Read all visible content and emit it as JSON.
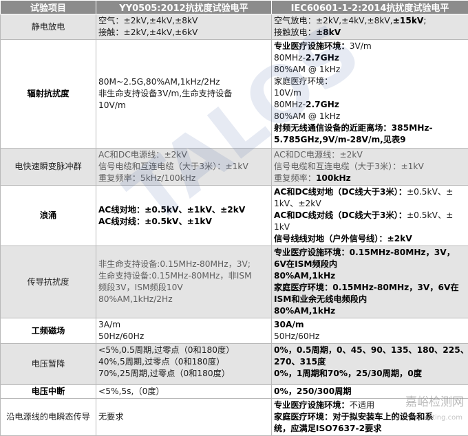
{
  "headers": [
    "试验项目",
    "YY0505:2012抗扰度试验电平",
    "IEC60601-1-2:2014抗扰度试验电平"
  ],
  "rows": [
    {
      "name": "静电放电",
      "yy": [
        "空气：±2kV,±4kV,±8kV",
        "接触：±2kV,±4kV,±6kV"
      ],
      "iec": [
        [
          {
            "t": "空气放电：±2kV,±4kV,±8kV,",
            "b": false
          },
          {
            "t": "±15kV",
            "b": true
          },
          {
            "t": ";",
            "b": false
          }
        ],
        [
          {
            "t": "接触放电：",
            "b": false
          },
          {
            "t": "±8kV",
            "b": true
          }
        ]
      ]
    },
    {
      "name": "辐射抗扰度",
      "yy": [
        "80M~2.5G,80%AM,1kHz/2Hz",
        "非生命支持设备3V/m,生命支持设备",
        "10V/m"
      ],
      "iec": [
        [
          {
            "t": "专业医疗设施环境：",
            "b": true
          },
          {
            "t": "3V/m",
            "b": false
          }
        ],
        [
          {
            "t": "80MHz-",
            "b": false
          },
          {
            "t": "2.7GHz",
            "b": true
          }
        ],
        [
          {
            "t": "80%AM @ 1kHz",
            "b": false
          }
        ],
        [
          {
            "t": "家庭医疗环境：",
            "b": false
          }
        ],
        [
          {
            "t": "10V/m",
            "b": false
          }
        ],
        [
          {
            "t": "80MHz-",
            "b": false
          },
          {
            "t": "2.7GHz",
            "b": true
          }
        ],
        [
          {
            "t": "80%AM @ 1kHz",
            "b": false
          }
        ],
        [
          {
            "t": "射频无线通信设备的近距离场：385MHz-",
            "b": true
          }
        ],
        [
          {
            "t": "5.785GHz,9V/m-28V/m,见表9",
            "b": true
          }
        ]
      ]
    },
    {
      "name": "电快速瞬变脉冲群",
      "yy": [
        "AC和DC电源线：±2kV",
        "信号电缆和互连电缆（大于3米）：±1kV",
        "重复频率：5kHz/100kHz"
      ],
      "iec": [
        [
          {
            "t": "AC和DC电源线：±2kV",
            "b": false
          }
        ],
        [
          {
            "t": "信号电缆和互连电缆（大于3米）：±1kV",
            "b": false
          }
        ],
        [
          {
            "t": "重复频率：",
            "b": false
          },
          {
            "t": "100kHz",
            "b": true
          }
        ]
      ]
    },
    {
      "name": "浪涌",
      "yy": [
        "AC线对地：±0.5kV、±1kV、±2kV",
        "AC线对线：±0.5kV、±1kV"
      ],
      "iec": [
        [
          {
            "t": "AC和DC线对地（DC线大于3米）：",
            "b": true
          },
          {
            "t": "±0.5kV、±",
            "b": false
          }
        ],
        [
          {
            "t": "1kV、±2kV",
            "b": false
          }
        ],
        [
          {
            "t": "AC和DC线对线（DC线大于3米）：",
            "b": true
          },
          {
            "t": "±0.5kV、±",
            "b": false
          }
        ],
        [
          {
            "t": "1kV",
            "b": false
          }
        ],
        [
          {
            "t": "信号线线对地（户外信号线）：±2kV",
            "b": true
          }
        ]
      ]
    },
    {
      "name": "传导抗扰度",
      "yy": [
        "非生命支持设备:0.15MHz-80MHz，3V;",
        "生命支持设备:0.15MHz-80MHz，非ISM",
        "频段3V，ISM频段10V",
        "80%AM,1kHz/2Hz"
      ],
      "iec": [
        [
          {
            "t": "专业医疗设施环境：0.15MHz-80MHz，3V，",
            "b": true
          }
        ],
        [
          {
            "t": "6V在ISM频段内",
            "b": true
          }
        ],
        [
          {
            "t": "80%AM,1kHz",
            "b": true
          }
        ],
        [
          {
            "t": "家庭医疗环境：0.15MHz-80MHz，3V，6V在",
            "b": true
          }
        ],
        [
          {
            "t": "ISM和业余无线电频段内",
            "b": true
          }
        ],
        [
          {
            "t": "80%AM,1kHz",
            "b": true
          }
        ]
      ]
    },
    {
      "name": "工频磁场",
      "yy": [
        "3A/m",
        "50Hz/60Hz"
      ],
      "iec": [
        [
          {
            "t": "30A/m",
            "b": true
          }
        ],
        [
          {
            "t": "50Hz/60Hz",
            "b": false
          }
        ]
      ]
    },
    {
      "name": "电压暂降",
      "yy": [
        "<5%,0.5周期,过零点（0和180度）",
        "40%,5周期,过零点（0和180度）",
        "70%,25周期,过零点（0和180度）"
      ],
      "iec": [
        [
          {
            "t": "0%，0.5周期，0、45、90、135、180、225、",
            "b": true
          }
        ],
        [
          {
            "t": "270、315度",
            "b": true
          }
        ],
        [
          {
            "t": "0%，1周期和70%，25/30周期，0度",
            "b": true
          }
        ]
      ]
    },
    {
      "name": "电压中断",
      "yy": [
        "<5%,5s,（0度）"
      ],
      "iec": [
        [
          {
            "t": "0%，250/300周期",
            "b": true
          }
        ]
      ]
    },
    {
      "name": "沿电源线的电瞬态传导",
      "yy": [
        "无要求"
      ],
      "iec": [
        [
          {
            "t": "专业医疗设施环境：",
            "b": true
          },
          {
            "t": "不适用",
            "b": false
          }
        ],
        [
          {
            "t": "家庭医疗环境：对于拟安装车上的设备和系",
            "b": true
          }
        ],
        [
          {
            "t": "统，应满足ISO7637-2要求",
            "b": true
          }
        ]
      ]
    }
  ],
  "watermark": {
    "big": "TALOS",
    "site": "嘉峪检测网",
    "url": "www.anytesting.com"
  }
}
